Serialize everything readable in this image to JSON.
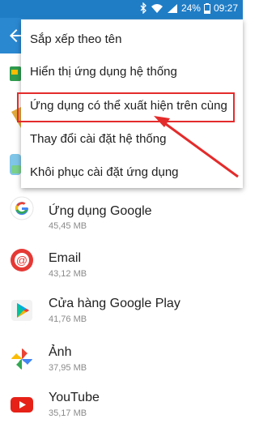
{
  "status_bar": {
    "battery": "24%",
    "time": "09:27",
    "icons": [
      "bluetooth-icon",
      "wifi-icon",
      "signal-icon",
      "battery-icon"
    ]
  },
  "app_bar": {
    "back_icon": "back-arrow-icon",
    "color": "#2a88d1"
  },
  "menu": {
    "items": [
      {
        "label": "Sắp xếp theo tên"
      },
      {
        "label": "Hiển thị ứng dụng hệ thống"
      },
      {
        "label": "Ứng dụng có thể xuất hiện trên cùng"
      },
      {
        "label": "Thay đổi cài đặt hệ thống"
      },
      {
        "label": "Khôi phục cài đặt ứng dụng"
      }
    ],
    "highlighted_index": 2,
    "highlight_color": "#e42b2b"
  },
  "apps": [
    {
      "name": "Ứng dụng Google",
      "size": "45,45 MB",
      "icon": "google-icon"
    },
    {
      "name": "Email",
      "size": "43,12 MB",
      "icon": "email-icon"
    },
    {
      "name": "Cửa hàng Google Play",
      "size": "41,76 MB",
      "icon": "play-store-icon"
    },
    {
      "name": "Ảnh",
      "size": "37,95 MB",
      "icon": "photos-icon"
    },
    {
      "name": "YouTube",
      "size": "35,17 MB",
      "icon": "youtube-icon"
    }
  ]
}
